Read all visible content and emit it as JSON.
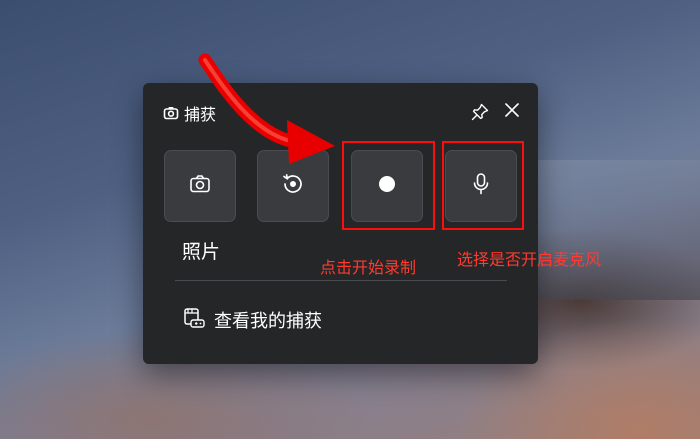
{
  "capture_panel": {
    "title": "捕获",
    "mode_label": "照片",
    "gallery_link": "查看我的捕获"
  },
  "annotations": {
    "record_hint": "点击开始录制",
    "mic_hint": "选择是否开启麦克风"
  },
  "colors": {
    "panel_bg": "#252628",
    "button_bg": "#3a3b3e",
    "annotation_red": "#ff0d0d"
  },
  "icons": {
    "title": "camera-icon",
    "pin": "pin-icon",
    "close": "close-icon",
    "screenshot": "camera-icon",
    "record_last": "record-last-icon",
    "record": "record-dot-icon",
    "microphone": "microphone-icon",
    "gallery": "gallery-icon"
  }
}
